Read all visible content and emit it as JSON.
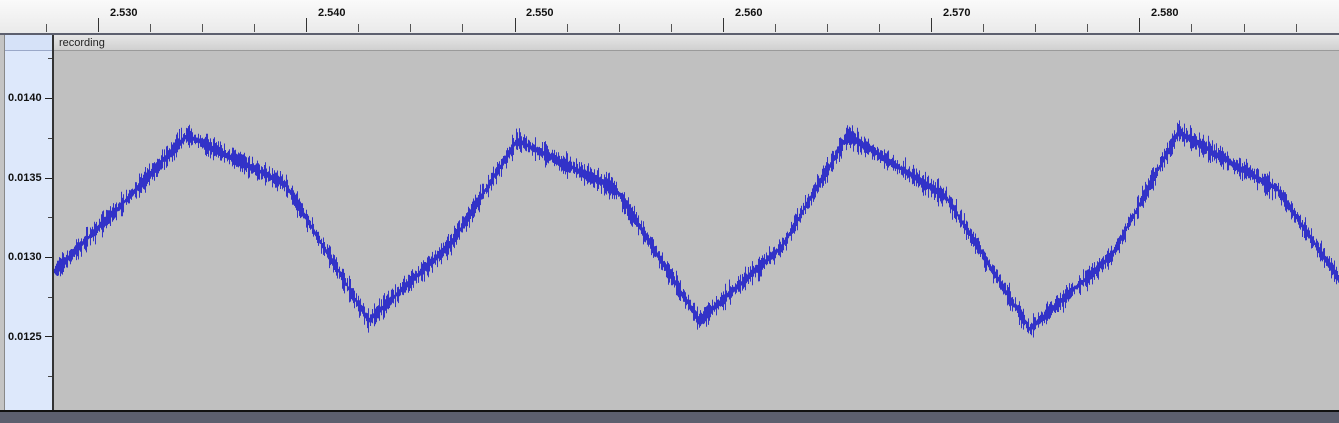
{
  "timeline": {
    "ticks": [
      "2.530",
      "2.540",
      "2.550",
      "2.560",
      "2.570",
      "2.580"
    ]
  },
  "track": {
    "clip_name": "recording",
    "amplitude_ticks": [
      "0.0140",
      "0.0135",
      "0.0130",
      "0.0125"
    ]
  },
  "colors": {
    "waveform": "#3232c8",
    "background": "#c0c0c0",
    "vruler": "#dde8fb"
  },
  "chart_data": {
    "type": "line",
    "title": "",
    "xlabel": "",
    "ylabel": "",
    "xlim": [
      2.5253,
      2.5875
    ],
    "ylim": [
      0.0121,
      0.0143
    ],
    "series": [
      {
        "x": [
          2.5253,
          2.5285,
          2.5317,
          2.5365,
          2.5405,
          2.5445,
          2.5477,
          2.5525,
          2.5565,
          2.5605,
          2.5637,
          2.5685,
          2.5725,
          2.5765,
          2.5797,
          2.5845,
          2.5875
        ],
        "values": [
          0.01295,
          0.01335,
          0.01378,
          0.01348,
          0.01265,
          0.01312,
          0.01375,
          0.01345,
          0.01265,
          0.0131,
          0.01378,
          0.0134,
          0.0126,
          0.01305,
          0.0138,
          0.01345,
          0.0129
        ]
      }
    ]
  }
}
